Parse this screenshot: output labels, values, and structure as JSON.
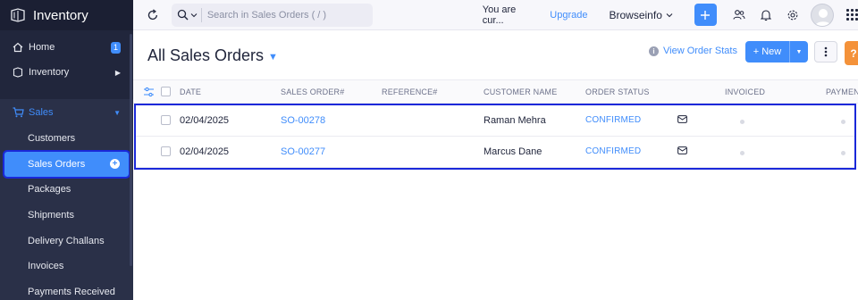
{
  "app": {
    "title": "Inventory"
  },
  "sidebar": {
    "home": {
      "label": "Home",
      "badge": "1"
    },
    "inventory": {
      "label": "Inventory"
    },
    "sales": {
      "label": "Sales",
      "items": [
        {
          "label": "Customers"
        },
        {
          "label": "Sales Orders",
          "active": true
        },
        {
          "label": "Packages"
        },
        {
          "label": "Shipments"
        },
        {
          "label": "Delivery Challans"
        },
        {
          "label": "Invoices"
        },
        {
          "label": "Payments Received"
        }
      ]
    }
  },
  "topbar": {
    "search_placeholder": "Search in Sales Orders ( / )",
    "trial_text": "You are cur...",
    "upgrade_label": "Upgrade",
    "org_name": "Browseinfo"
  },
  "header": {
    "title": "All Sales Orders",
    "view_stats_label": "View Order Stats",
    "new_button_label": "+ New",
    "help_label": "?"
  },
  "table": {
    "columns": {
      "date": "DATE",
      "sales_order": "SALES ORDER#",
      "reference": "REFERENCE#",
      "customer_name": "CUSTOMER NAME",
      "order_status": "ORDER STATUS",
      "invoiced": "INVOICED",
      "payment": "PAYMEN"
    },
    "rows": [
      {
        "date": "02/04/2025",
        "sales_order": "SO-00278",
        "reference": "",
        "customer_name": "Raman Mehra",
        "order_status": "CONFIRMED"
      },
      {
        "date": "02/04/2025",
        "sales_order": "SO-00277",
        "reference": "",
        "customer_name": "Marcus Dane",
        "order_status": "CONFIRMED"
      }
    ]
  },
  "colors": {
    "sidebar_bg": "#21263c",
    "accent": "#408dfb",
    "highlight_outline": "#1a28d9",
    "help_button": "#f4923a"
  }
}
